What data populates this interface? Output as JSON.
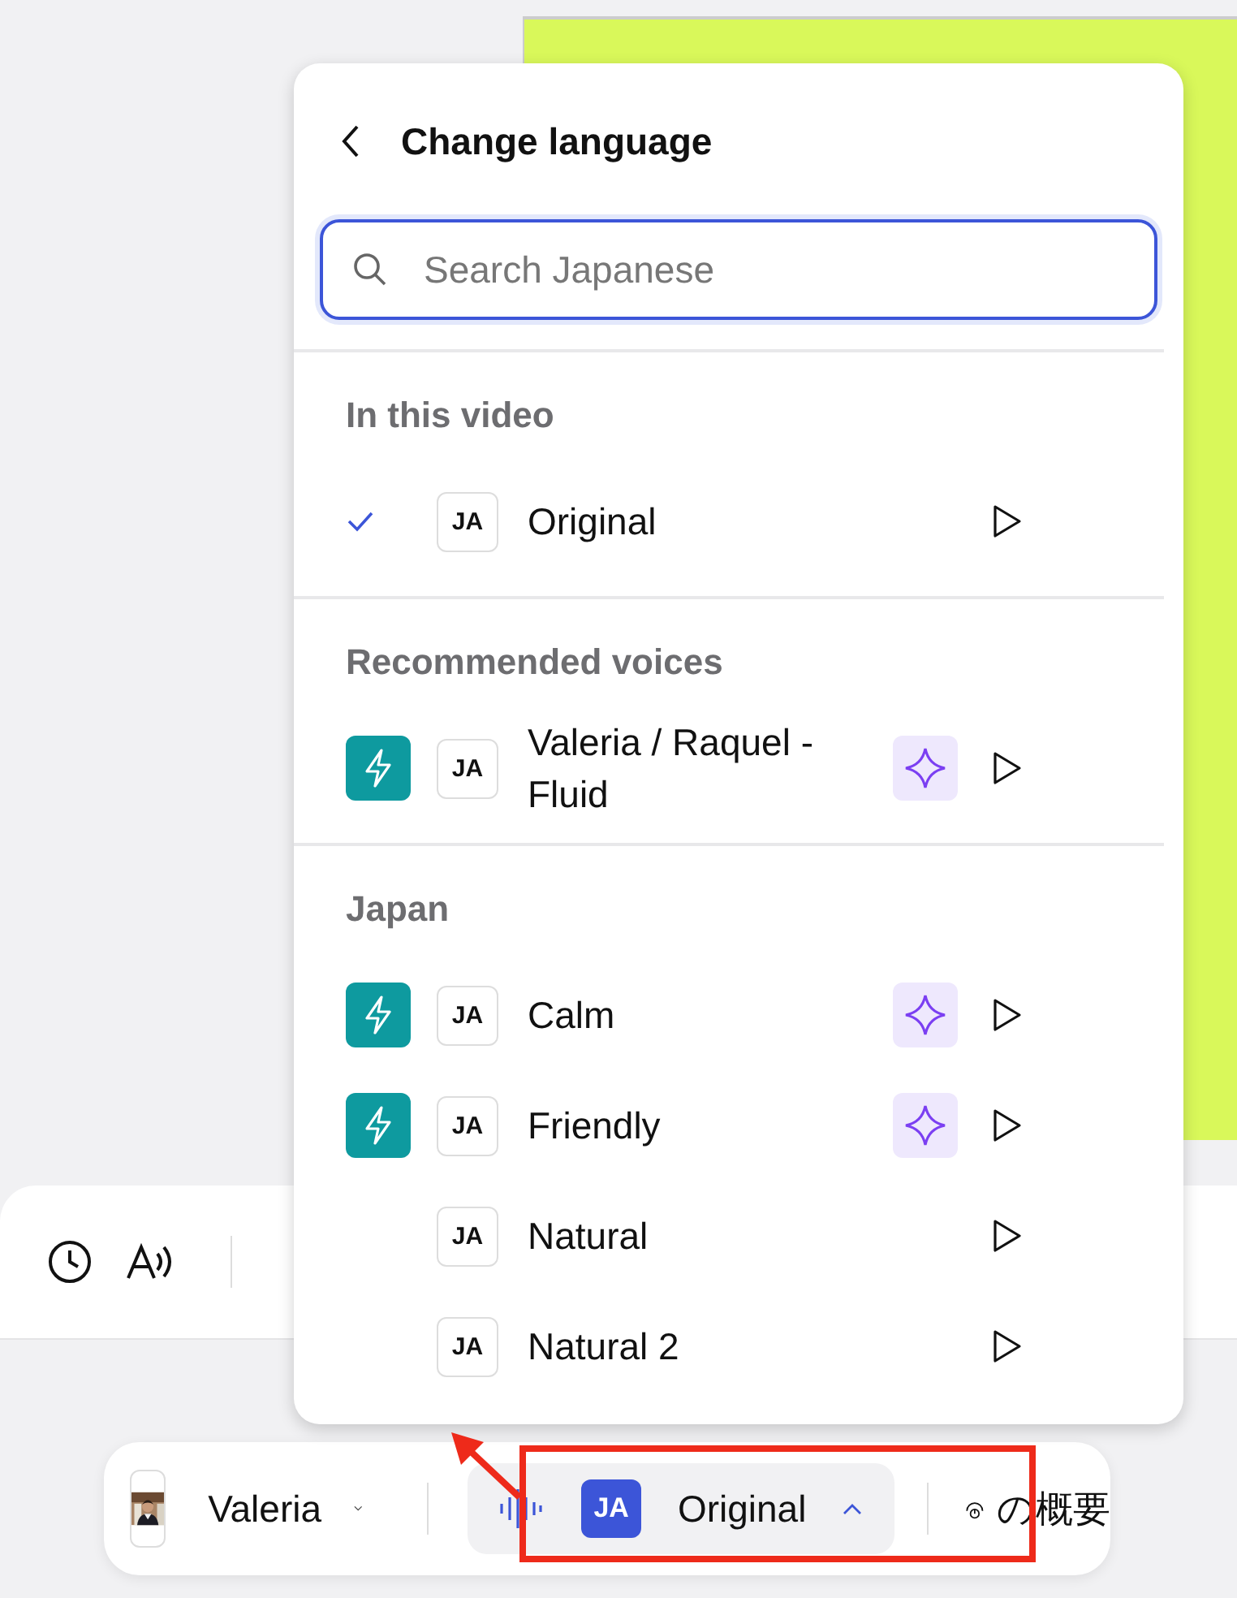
{
  "popup": {
    "title": "Change language",
    "search": {
      "placeholder": "Search Japanese"
    },
    "sections": [
      {
        "heading": "In this video",
        "items": [
          {
            "code": "JA",
            "name": "Original",
            "selected": true,
            "fast": false,
            "ai": false
          }
        ]
      },
      {
        "heading": "Recommended voices",
        "items": [
          {
            "code": "JA",
            "name": "Valeria / Raquel - Fluid",
            "selected": false,
            "fast": true,
            "ai": true
          }
        ]
      },
      {
        "heading": "Japan",
        "items": [
          {
            "code": "JA",
            "name": "Calm",
            "selected": false,
            "fast": true,
            "ai": true
          },
          {
            "code": "JA",
            "name": "Friendly",
            "selected": false,
            "fast": true,
            "ai": true
          },
          {
            "code": "JA",
            "name": "Natural",
            "selected": false,
            "fast": false,
            "ai": false
          },
          {
            "code": "JA",
            "name": "Natural 2",
            "selected": false,
            "fast": false,
            "ai": false
          }
        ]
      }
    ]
  },
  "player_bar": {
    "speaker": "Valeria",
    "language_code": "JA",
    "voice": "Original",
    "expanded": true,
    "summary": "の概要"
  }
}
